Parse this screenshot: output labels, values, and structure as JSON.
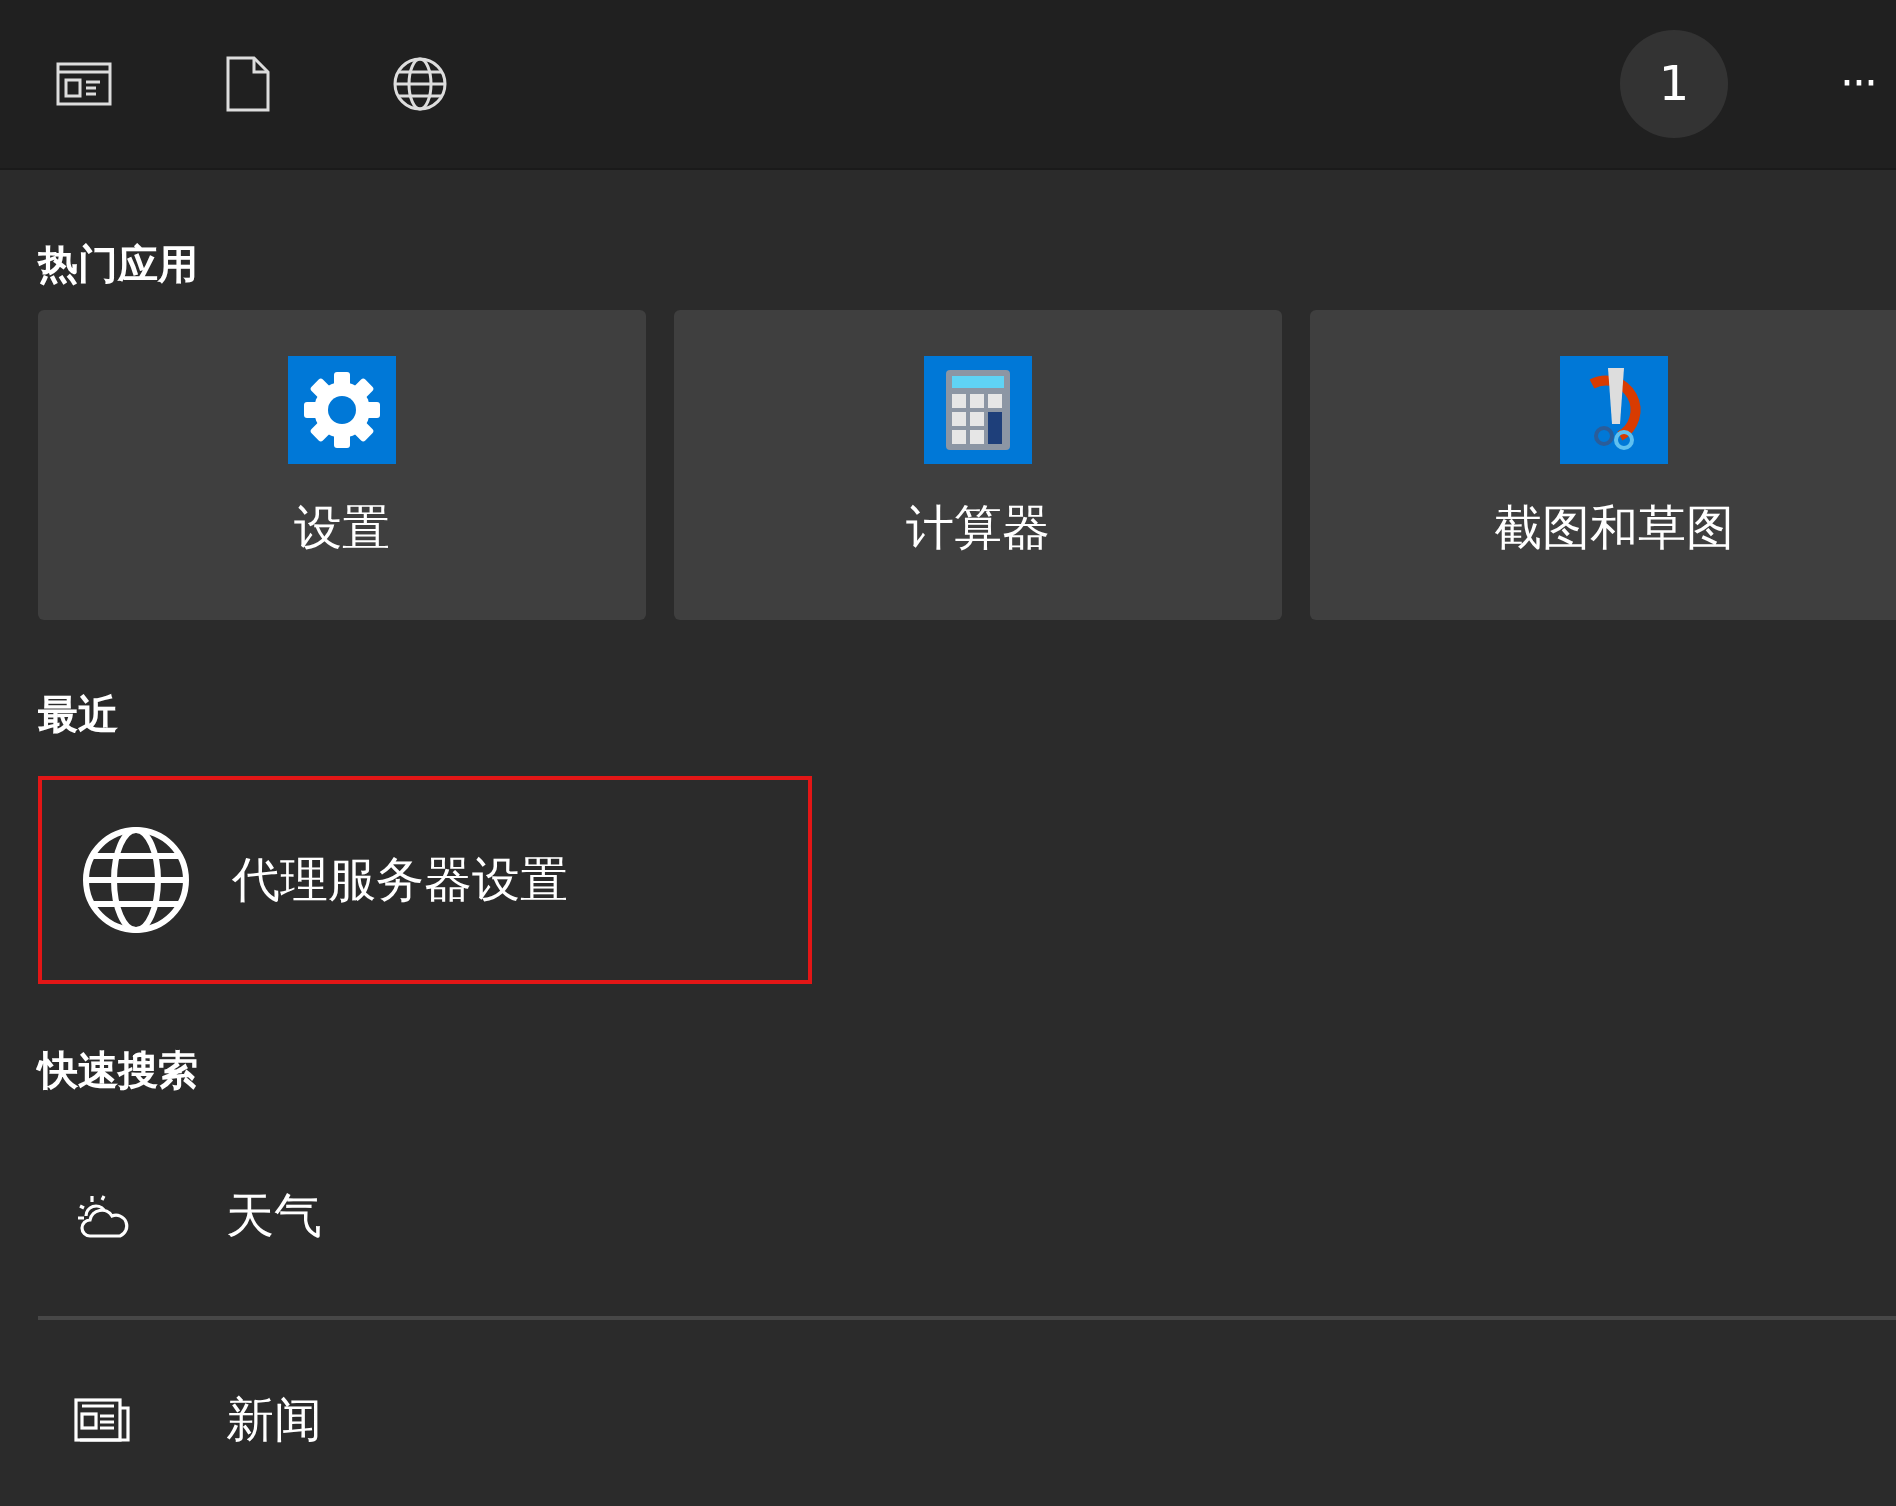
{
  "top_bar": {
    "buttons": [
      {
        "kind": "apps"
      },
      {
        "kind": "documents"
      },
      {
        "kind": "web"
      }
    ],
    "badge": "1",
    "more": "···"
  },
  "top_apps": {
    "heading": "热门应用",
    "items": [
      {
        "label": "设置",
        "kind": "settings"
      },
      {
        "label": "计算器",
        "kind": "calculator"
      },
      {
        "label": "截图和草图",
        "kind": "snip"
      }
    ]
  },
  "recent": {
    "heading": "最近",
    "items": [
      {
        "label": "代理服务器设置",
        "highlighted": true
      }
    ]
  },
  "quick_search": {
    "heading": "快速搜索",
    "items": [
      {
        "label": "天气",
        "kind": "weather"
      },
      {
        "label": "新闻",
        "kind": "news"
      }
    ]
  }
}
